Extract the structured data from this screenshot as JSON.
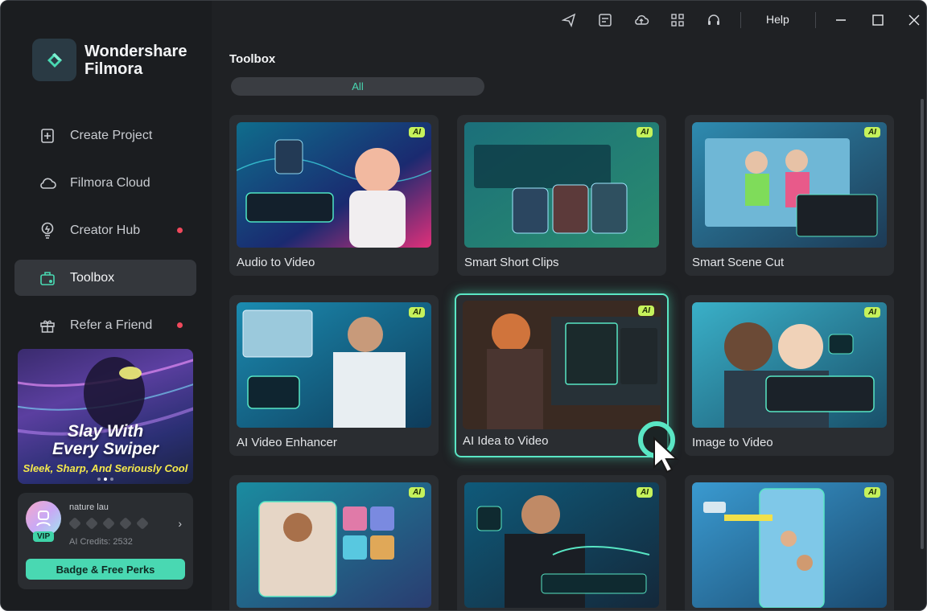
{
  "app": {
    "brand_line1": "Wondershare",
    "brand_line2": "Filmora"
  },
  "sidebar": {
    "items": [
      {
        "label": "Create Project",
        "icon": "plus-square-icon",
        "dot": false
      },
      {
        "label": "Filmora Cloud",
        "icon": "cloud-icon",
        "dot": false
      },
      {
        "label": "Creator Hub",
        "icon": "bulb-icon",
        "dot": true
      },
      {
        "label": "Toolbox",
        "icon": "toolbox-icon",
        "dot": false,
        "active": true
      },
      {
        "label": "Refer a Friend",
        "icon": "gift-icon",
        "dot": true
      }
    ],
    "promo": {
      "title_line1": "Slay With",
      "title_line2": "Every Swiper",
      "subtitle": "Sleek, Sharp, And Seriously Cool"
    },
    "user": {
      "name": "nature lau",
      "vip_label": "VIP",
      "credits": "AI Credits: 2532",
      "perks_button": "Badge & Free Perks"
    }
  },
  "titlebar": {
    "icons": [
      "send-icon",
      "task-icon",
      "cloud-upload-icon",
      "grid-icon",
      "headset-icon"
    ],
    "help_label": "Help"
  },
  "main": {
    "title": "Toolbox",
    "filter_label": "All",
    "ai_badge": "AI",
    "cards": [
      {
        "label": "Audio to Video"
      },
      {
        "label": "Smart Short Clips"
      },
      {
        "label": "Smart Scene Cut"
      },
      {
        "label": "AI Video Enhancer"
      },
      {
        "label": "AI Idea to Video",
        "selected": true
      },
      {
        "label": "Image to Video"
      },
      {
        "label": ""
      },
      {
        "label": ""
      },
      {
        "label": ""
      }
    ]
  },
  "colors": {
    "accent": "#49d8b2",
    "ai_badge": "#c6f25b",
    "notification_dot": "#f0495c"
  }
}
